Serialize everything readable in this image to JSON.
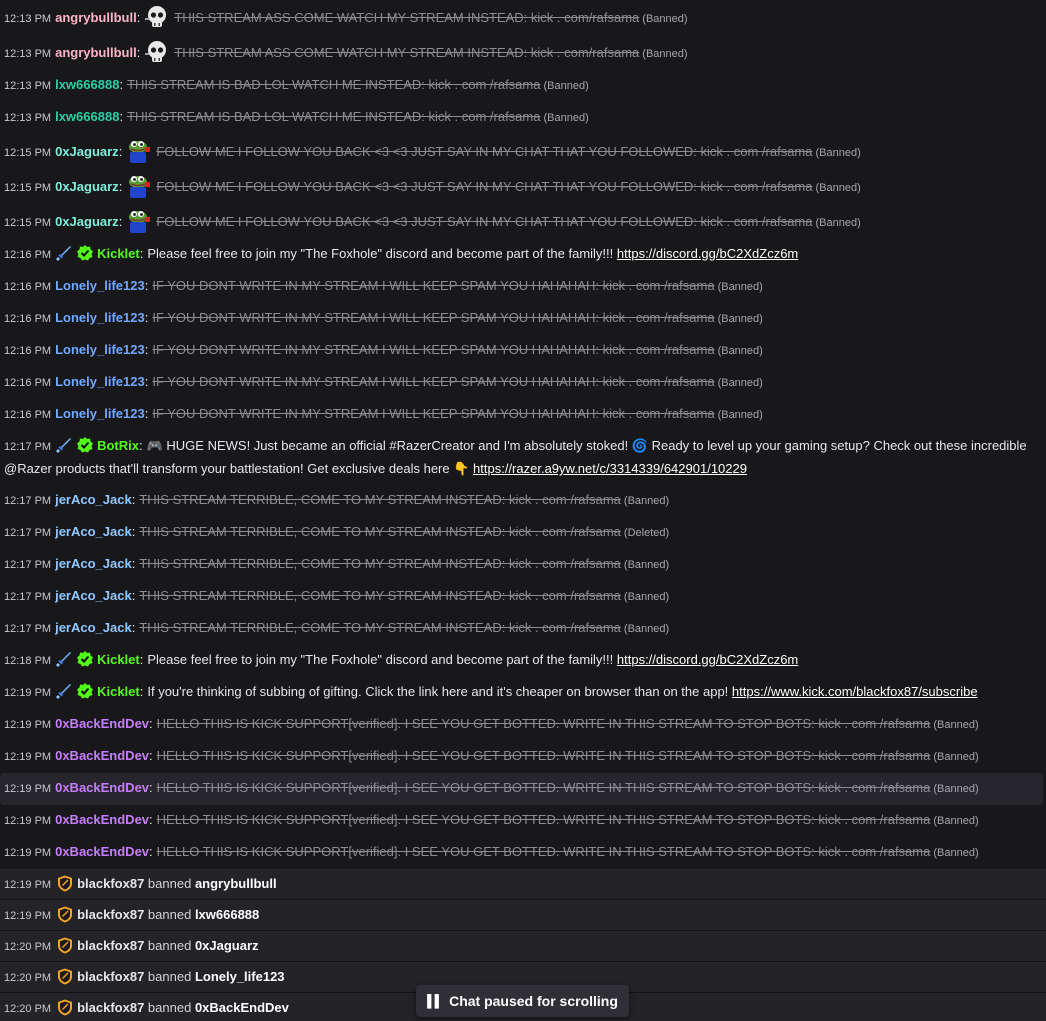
{
  "messages": [
    {
      "time": "12:13 PM",
      "user": "angrybullbull",
      "color": "#ffb3c6",
      "badges": [],
      "emote": "skull",
      "text": "THIS STREAM ASS COME WATCH MY STREAM INSTEAD: kick . com/rafsama",
      "deleted": true,
      "tag": "(Banned)"
    },
    {
      "time": "12:13 PM",
      "user": "angrybullbull",
      "color": "#ffb3c6",
      "badges": [],
      "emote": "skull",
      "text": "THIS STREAM ASS COME WATCH MY STREAM INSTEAD: kick . com/rafsama",
      "deleted": true,
      "tag": "(Banned)"
    },
    {
      "time": "12:13 PM",
      "user": "lxw666888",
      "color": "#2ad0a4",
      "badges": [],
      "text": "THIS STREAM IS BAD LOL WATCH ME INSTEAD: kick . com /rafsama",
      "deleted": true,
      "tag": "(Banned)"
    },
    {
      "time": "12:13 PM",
      "user": "lxw666888",
      "color": "#2ad0a4",
      "badges": [],
      "text": "THIS STREAM IS BAD LOL WATCH ME INSTEAD: kick . com /rafsama",
      "deleted": true,
      "tag": "(Banned)"
    },
    {
      "time": "12:15 PM",
      "user": "0xJaguarz",
      "color": "#7cf0dc",
      "badges": [],
      "emote": "frog",
      "text": "FOLLOW ME I FOLLOW YOU BACK <3 <3 JUST SAY IN MY CHAT THAT YOU FOLLOWED: kick . com /rafsama",
      "deleted": true,
      "tag": "(Banned)"
    },
    {
      "time": "12:15 PM",
      "user": "0xJaguarz",
      "color": "#7cf0dc",
      "badges": [],
      "emote": "frog",
      "text": "FOLLOW ME I FOLLOW YOU BACK <3 <3 JUST SAY IN MY CHAT THAT YOU FOLLOWED: kick . com /rafsama",
      "deleted": true,
      "tag": "(Banned)"
    },
    {
      "time": "12:15 PM",
      "user": "0xJaguarz",
      "color": "#7cf0dc",
      "badges": [],
      "emote": "frog",
      "text": "FOLLOW ME I FOLLOW YOU BACK <3 <3 JUST SAY IN MY CHAT THAT YOU FOLLOWED: kick . com /rafsama",
      "deleted": true,
      "tag": "(Banned)"
    },
    {
      "time": "12:16 PM",
      "user": "Kicklet",
      "color": "#53fc18",
      "badges": [
        "sword",
        "verified"
      ],
      "text": "Please feel free to join my \"The Foxhole\" discord and become part of the family!!!",
      "link": "https://discord.gg/bC2XdZcz6m",
      "deleted": false
    },
    {
      "time": "12:16 PM",
      "user": "Lonely_life123",
      "color": "#6fa8ff",
      "badges": [],
      "text": "IF YOU DONT WRITE IN MY STREAM I WILL KEEP SPAM YOU HAHAHAH: kick . com /rafsama",
      "deleted": true,
      "tag": "(Banned)"
    },
    {
      "time": "12:16 PM",
      "user": "Lonely_life123",
      "color": "#6fa8ff",
      "badges": [],
      "text": "IF YOU DONT WRITE IN MY STREAM I WILL KEEP SPAM YOU HAHAHAH: kick . com /rafsama",
      "deleted": true,
      "tag": "(Banned)"
    },
    {
      "time": "12:16 PM",
      "user": "Lonely_life123",
      "color": "#6fa8ff",
      "badges": [],
      "text": "IF YOU DONT WRITE IN MY STREAM I WILL KEEP SPAM YOU HAHAHAH: kick . com /rafsama",
      "deleted": true,
      "tag": "(Banned)"
    },
    {
      "time": "12:16 PM",
      "user": "Lonely_life123",
      "color": "#6fa8ff",
      "badges": [],
      "text": "IF YOU DONT WRITE IN MY STREAM I WILL KEEP SPAM YOU HAHAHAH: kick . com /rafsama",
      "deleted": true,
      "tag": "(Banned)"
    },
    {
      "time": "12:16 PM",
      "user": "Lonely_life123",
      "color": "#6fa8ff",
      "badges": [],
      "text": "IF YOU DONT WRITE IN MY STREAM I WILL KEEP SPAM YOU HAHAHAH: kick . com /rafsama",
      "deleted": true,
      "tag": "(Banned)"
    },
    {
      "time": "12:17 PM",
      "user": "BotRix",
      "color": "#53fc18",
      "badges": [
        "sword",
        "verified"
      ],
      "text": "🎮 HUGE NEWS! Just became an official #RazerCreator and I'm absolutely stoked! 🌀 Ready to level up your gaming setup? Check out these incredible @Razer products that'll transform your battlestation! Get exclusive deals here 👇",
      "link": "https://razer.a9yw.net/c/3314339/642901/10229",
      "deleted": false
    },
    {
      "time": "12:17 PM",
      "user": "jerAco_Jack",
      "color": "#8fc7ff",
      "badges": [],
      "text": "THIS STREAM TERRIBLE, COME TO MY STREAM INSTEAD: kick . com /rafsama",
      "deleted": true,
      "tag": "(Banned)"
    },
    {
      "time": "12:17 PM",
      "user": "jerAco_Jack",
      "color": "#8fc7ff",
      "badges": [],
      "text": "THIS STREAM TERRIBLE, COME TO MY STREAM INSTEAD: kick . com /rafsama",
      "deleted": true,
      "tag": "(Deleted)"
    },
    {
      "time": "12:17 PM",
      "user": "jerAco_Jack",
      "color": "#8fc7ff",
      "badges": [],
      "text": "THIS STREAM TERRIBLE, COME TO MY STREAM INSTEAD: kick . com /rafsama",
      "deleted": true,
      "tag": "(Banned)"
    },
    {
      "time": "12:17 PM",
      "user": "jerAco_Jack",
      "color": "#8fc7ff",
      "badges": [],
      "text": "THIS STREAM TERRIBLE, COME TO MY STREAM INSTEAD: kick . com /rafsama",
      "deleted": true,
      "tag": "(Banned)"
    },
    {
      "time": "12:17 PM",
      "user": "jerAco_Jack",
      "color": "#8fc7ff",
      "badges": [],
      "text": "THIS STREAM TERRIBLE, COME TO MY STREAM INSTEAD: kick . com /rafsama",
      "deleted": true,
      "tag": "(Banned)"
    },
    {
      "time": "12:18 PM",
      "user": "Kicklet",
      "color": "#53fc18",
      "badges": [
        "sword",
        "verified"
      ],
      "text": "Please feel free to join my \"The Foxhole\" discord and become part of the family!!!",
      "link": "https://discord.gg/bC2XdZcz6m",
      "deleted": false
    },
    {
      "time": "12:19 PM",
      "user": "Kicklet",
      "color": "#53fc18",
      "badges": [
        "sword",
        "verified"
      ],
      "text": "If you're thinking of subbing of gifting. Click the link here and it's cheaper on browser than on the app!",
      "link": "https://www.kick.com/blackfox87/subscribe",
      "deleted": false
    },
    {
      "time": "12:19 PM",
      "user": "0xBackEndDev",
      "color": "#c77dff",
      "badges": [],
      "text": "HELLO THIS IS KICK SUPPORT[verified]. I SEE YOU GET BOTTED. WRITE IN THIS STREAM TO STOP BOTS: kick . com /rafsama",
      "deleted": true,
      "tag": "(Banned)"
    },
    {
      "time": "12:19 PM",
      "user": "0xBackEndDev",
      "color": "#c77dff",
      "badges": [],
      "text": "HELLO THIS IS KICK SUPPORT[verified]. I SEE YOU GET BOTTED. WRITE IN THIS STREAM TO STOP BOTS: kick . com /rafsama",
      "deleted": true,
      "tag": "(Banned)"
    },
    {
      "time": "12:19 PM",
      "user": "0xBackEndDev",
      "color": "#c77dff",
      "badges": [],
      "text": "HELLO THIS IS KICK SUPPORT[verified]. I SEE YOU GET BOTTED. WRITE IN THIS STREAM TO STOP BOTS: kick . com /rafsama",
      "deleted": true,
      "tag": "(Banned)",
      "highlight": true
    },
    {
      "time": "12:19 PM",
      "user": "0xBackEndDev",
      "color": "#c77dff",
      "badges": [],
      "text": "HELLO THIS IS KICK SUPPORT[verified]. I SEE YOU GET BOTTED. WRITE IN THIS STREAM TO STOP BOTS: kick . com /rafsama",
      "deleted": true,
      "tag": "(Banned)"
    },
    {
      "time": "12:19 PM",
      "user": "0xBackEndDev",
      "color": "#c77dff",
      "badges": [],
      "text": "HELLO THIS IS KICK SUPPORT[verified]. I SEE YOU GET BOTTED. WRITE IN THIS STREAM TO STOP BOTS: kick . com /rafsama",
      "deleted": true,
      "tag": "(Banned)"
    }
  ],
  "mod_actions": [
    {
      "time": "12:19 PM",
      "moderator": "blackfox87",
      "action": "banned",
      "target": "angrybullbull"
    },
    {
      "time": "12:19 PM",
      "moderator": "blackfox87",
      "action": "banned",
      "target": "lxw666888"
    },
    {
      "time": "12:20 PM",
      "moderator": "blackfox87",
      "action": "banned",
      "target": "0xJaguarz"
    },
    {
      "time": "12:20 PM",
      "moderator": "blackfox87",
      "action": "banned",
      "target": "Lonely_life123"
    },
    {
      "time": "12:20 PM",
      "moderator": "blackfox87",
      "action": "banned",
      "target": "0xBackEndDev"
    }
  ],
  "pause_banner": {
    "label": "Chat paused for scrolling",
    "icon": "pause-icon"
  },
  "colors": {
    "background": "#18181b",
    "system_row": "#232328",
    "kick_green": "#53fc18",
    "mod_shield": "#f5a524"
  }
}
